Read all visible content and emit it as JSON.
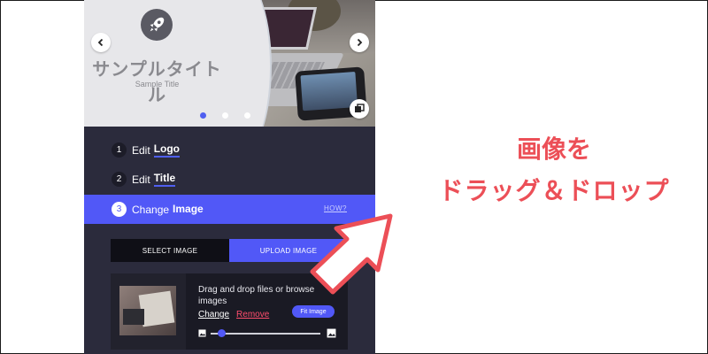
{
  "hero": {
    "title": "サンプルタイトル",
    "subtitle": "Sample Title",
    "carousel_dots": 3,
    "active_dot": 0
  },
  "steps": [
    {
      "num": "1",
      "verb": "Edit",
      "key": "Logo"
    },
    {
      "num": "2",
      "verb": "Edit",
      "key": "Title"
    },
    {
      "num": "3",
      "verb": "Change",
      "key": "Image",
      "howto": "HOW?"
    }
  ],
  "image_tabs": {
    "select_label": "SELECT IMAGE",
    "upload_label": "UPLOAD IMAGE",
    "active": "upload"
  },
  "upload": {
    "prompt": "Drag and drop files or browse images",
    "change_label": "Change",
    "remove_label": "Remove",
    "fit_label": "Fit Image",
    "zoom_level": 0.1
  },
  "annotation": {
    "line1": "画像を",
    "line2": "ドラッグ＆ドロップ"
  },
  "colors": {
    "accent": "#5158f7",
    "annotation": "#ec4f57",
    "panel": "#2b2b3c",
    "remove": "#ff4d6d"
  },
  "icons": [
    "rocket-icon",
    "chevron-left-icon",
    "chevron-right-icon",
    "copy-icon",
    "image-small-icon",
    "image-large-icon",
    "arrow-annotation-icon"
  ]
}
